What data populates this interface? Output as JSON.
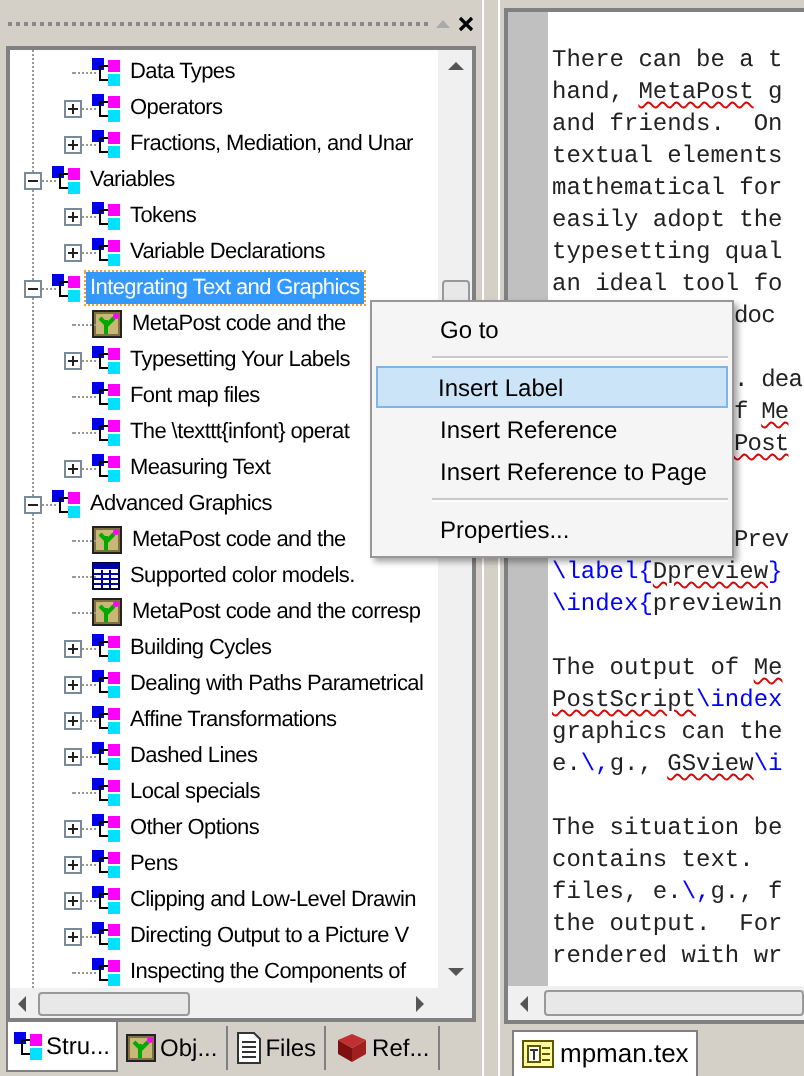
{
  "tree": {
    "continued": [
      {
        "label": "Data Types",
        "kind": "section",
        "selected": false
      },
      {
        "label": "Operators",
        "kind": "section",
        "expanded": false,
        "selected": false
      },
      {
        "label": "Fractions, Mediation, and Unar",
        "kind": "section",
        "expanded": false,
        "selected": false
      }
    ],
    "items": [
      {
        "label": "Variables",
        "kind": "section",
        "expanded": true,
        "selected": false,
        "children": [
          {
            "label": "Tokens",
            "kind": "section",
            "expanded": false,
            "selected": false
          },
          {
            "label": "Variable Declarations",
            "kind": "section",
            "expanded": false,
            "selected": false
          }
        ]
      },
      {
        "label": "Integrating Text and Graphics",
        "kind": "section",
        "expanded": true,
        "selected": true,
        "children": [
          {
            "label": "MetaPost code and the",
            "kind": "figure",
            "selected": false
          },
          {
            "label": "Typesetting Your Labels",
            "kind": "section",
            "expanded": false,
            "selected": false
          },
          {
            "label": "Font map files",
            "kind": "section",
            "selected": false
          },
          {
            "label": "The \\texttt{infont} operat",
            "kind": "section",
            "selected": false
          },
          {
            "label": "Measuring Text",
            "kind": "section",
            "expanded": false,
            "selected": false
          }
        ]
      },
      {
        "label": "Advanced Graphics",
        "kind": "section",
        "expanded": true,
        "selected": false,
        "children": [
          {
            "label": "MetaPost code and the",
            "kind": "figure",
            "selected": false
          },
          {
            "label": "Supported color models.",
            "kind": "table",
            "selected": false
          },
          {
            "label": "MetaPost code and the corresp",
            "kind": "figure",
            "selected": false
          },
          {
            "label": "Building Cycles",
            "kind": "section",
            "expanded": false,
            "selected": false
          },
          {
            "label": "Dealing with Paths Parametrical",
            "kind": "section",
            "expanded": false,
            "selected": false
          },
          {
            "label": "Affine Transformations",
            "kind": "section",
            "expanded": false,
            "selected": false
          },
          {
            "label": "Dashed Lines",
            "kind": "section",
            "expanded": false,
            "selected": false
          },
          {
            "label": "Local specials",
            "kind": "section",
            "selected": false
          },
          {
            "label": "Other Options",
            "kind": "section",
            "expanded": false,
            "selected": false
          },
          {
            "label": "Pens",
            "kind": "section",
            "expanded": false,
            "selected": false
          },
          {
            "label": "Clipping and Low-Level Drawin",
            "kind": "section",
            "expanded": false,
            "selected": false
          },
          {
            "label": "Directing Output to a Picture V",
            "kind": "section",
            "expanded": false,
            "selected": false
          },
          {
            "label": "Inspecting the Components of",
            "kind": "section",
            "selected": false
          }
        ]
      }
    ]
  },
  "panel_tabs": [
    {
      "label": "Stru...",
      "kind": "section",
      "selected": true
    },
    {
      "label": "Obj...",
      "kind": "figure",
      "selected": false
    },
    {
      "label": "Files",
      "kind": "file",
      "selected": false
    },
    {
      "label": "Ref...",
      "kind": "book",
      "selected": false
    }
  ],
  "context_menu": [
    {
      "kind": "item",
      "label": "Go to",
      "selected": false
    },
    {
      "kind": "separator"
    },
    {
      "kind": "item",
      "label": "Insert Label",
      "selected": true
    },
    {
      "kind": "item",
      "label": "Insert Reference",
      "selected": false
    },
    {
      "kind": "item",
      "label": "Insert Reference to Page",
      "selected": false
    },
    {
      "kind": "separator"
    },
    {
      "kind": "item",
      "label": "Properties...",
      "selected": false
    }
  ],
  "editor": {
    "lines": [
      {
        "kind": "full",
        "segments": [
          {
            "kind": "text",
            "text": "There can be a t"
          }
        ]
      },
      {
        "kind": "full",
        "segments": [
          {
            "kind": "text",
            "text": "hand, "
          },
          {
            "kind": "misspelled",
            "text": "MetaPost"
          },
          {
            "kind": "text",
            "text": " g"
          }
        ]
      },
      {
        "kind": "full",
        "segments": [
          {
            "kind": "text",
            "text": "and friends.  On"
          }
        ]
      },
      {
        "kind": "full",
        "segments": [
          {
            "kind": "text",
            "text": "textual elements"
          }
        ]
      },
      {
        "kind": "full",
        "segments": [
          {
            "kind": "text",
            "text": "mathematical for"
          }
        ]
      },
      {
        "kind": "full",
        "segments": [
          {
            "kind": "text",
            "text": "easily adopt the"
          }
        ]
      },
      {
        "kind": "full",
        "segments": [
          {
            "kind": "text",
            "text": "typesetting qual"
          }
        ]
      },
      {
        "kind": "full",
        "segments": [
          {
            "kind": "text",
            "text": "an ideal tool fo"
          }
        ]
      },
      {
        "kind": "covered",
        "segments": [
          {
            "kind": "text",
            "text": "doc"
          }
        ]
      },
      {
        "kind": "blank"
      },
      {
        "kind": "covered",
        "segments": [
          {
            "kind": "text",
            "text": ". dea"
          }
        ]
      },
      {
        "kind": "covered",
        "segments": [
          {
            "kind": "text",
            "text": "f "
          },
          {
            "kind": "misspelled",
            "text": "Me"
          }
        ]
      },
      {
        "kind": "covered",
        "segments": [
          {
            "kind": "misspelled",
            "text": "Post"
          }
        ]
      },
      {
        "kind": "blank"
      },
      {
        "kind": "blank"
      },
      {
        "kind": "covered",
        "segments": [
          {
            "kind": "text",
            "text": "Prev"
          }
        ]
      },
      {
        "kind": "full",
        "segments": [
          {
            "kind": "command",
            "text": "\\label{"
          },
          {
            "kind": "misspelled",
            "text": "Dpreview"
          },
          {
            "kind": "command",
            "text": "}"
          }
        ]
      },
      {
        "kind": "full",
        "segments": [
          {
            "kind": "command",
            "text": "\\index{"
          },
          {
            "kind": "text",
            "text": "previewin"
          }
        ]
      },
      {
        "kind": "blank"
      },
      {
        "kind": "full",
        "segments": [
          {
            "kind": "text",
            "text": "The output of "
          },
          {
            "kind": "misspelled",
            "text": "Me"
          }
        ]
      },
      {
        "kind": "full",
        "segments": [
          {
            "kind": "misspelled",
            "text": "PostScript"
          },
          {
            "kind": "command",
            "text": "\\index"
          }
        ]
      },
      {
        "kind": "full",
        "segments": [
          {
            "kind": "text",
            "text": "graphics can the"
          }
        ]
      },
      {
        "kind": "full",
        "segments": [
          {
            "kind": "text",
            "text": "e."
          },
          {
            "kind": "command",
            "text": "\\,"
          },
          {
            "kind": "text",
            "text": "g., "
          },
          {
            "kind": "misspelled",
            "text": "GSview"
          },
          {
            "kind": "command",
            "text": "\\i"
          }
        ]
      },
      {
        "kind": "blank"
      },
      {
        "kind": "full",
        "segments": [
          {
            "kind": "text",
            "text": "The situation be"
          }
        ]
      },
      {
        "kind": "full",
        "segments": [
          {
            "kind": "text",
            "text": "contains text."
          }
        ]
      },
      {
        "kind": "full",
        "segments": [
          {
            "kind": "text",
            "text": "files, e."
          },
          {
            "kind": "command",
            "text": "\\,"
          },
          {
            "kind": "text",
            "text": "g., f"
          }
        ]
      },
      {
        "kind": "full",
        "segments": [
          {
            "kind": "text",
            "text": "the output.  For"
          }
        ]
      },
      {
        "kind": "full",
        "segments": [
          {
            "kind": "text",
            "text": "rendered with wr"
          }
        ]
      }
    ],
    "tabs": [
      {
        "label": "mpman.tex",
        "selected": true
      }
    ]
  }
}
